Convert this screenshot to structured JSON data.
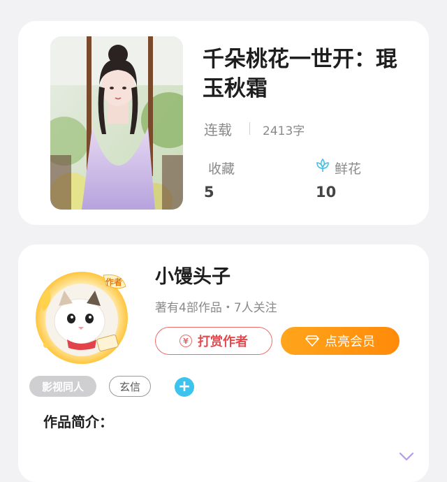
{
  "book": {
    "title": "千朵桃花一世开：琨玉秋霜",
    "status": "连载",
    "word_count": "2413字",
    "favorites_label": "收藏",
    "favorites_value": "5",
    "flowers_label": "鲜花",
    "flowers_value": "10",
    "flower_icon": "lotus-icon"
  },
  "author": {
    "name": "小馒头子",
    "meta": "著有4部作品・7人关注",
    "avatar_badge": "作者",
    "reward_button": "打赏作者",
    "reward_icon": "yen-icon",
    "reward_icon_glyph": "¥",
    "vip_button": "点亮会员",
    "vip_icon": "diamond-icon",
    "tags": [
      "影视同人",
      "玄信"
    ],
    "add_tag": "+",
    "intro_label": "作品简介："
  },
  "colors": {
    "background": "#f2f2f4",
    "reward_red": "#e5484d",
    "vip_orange": "#ff9a14",
    "add_blue": "#3cc3ee",
    "expand_purple": "#b59ce6"
  }
}
